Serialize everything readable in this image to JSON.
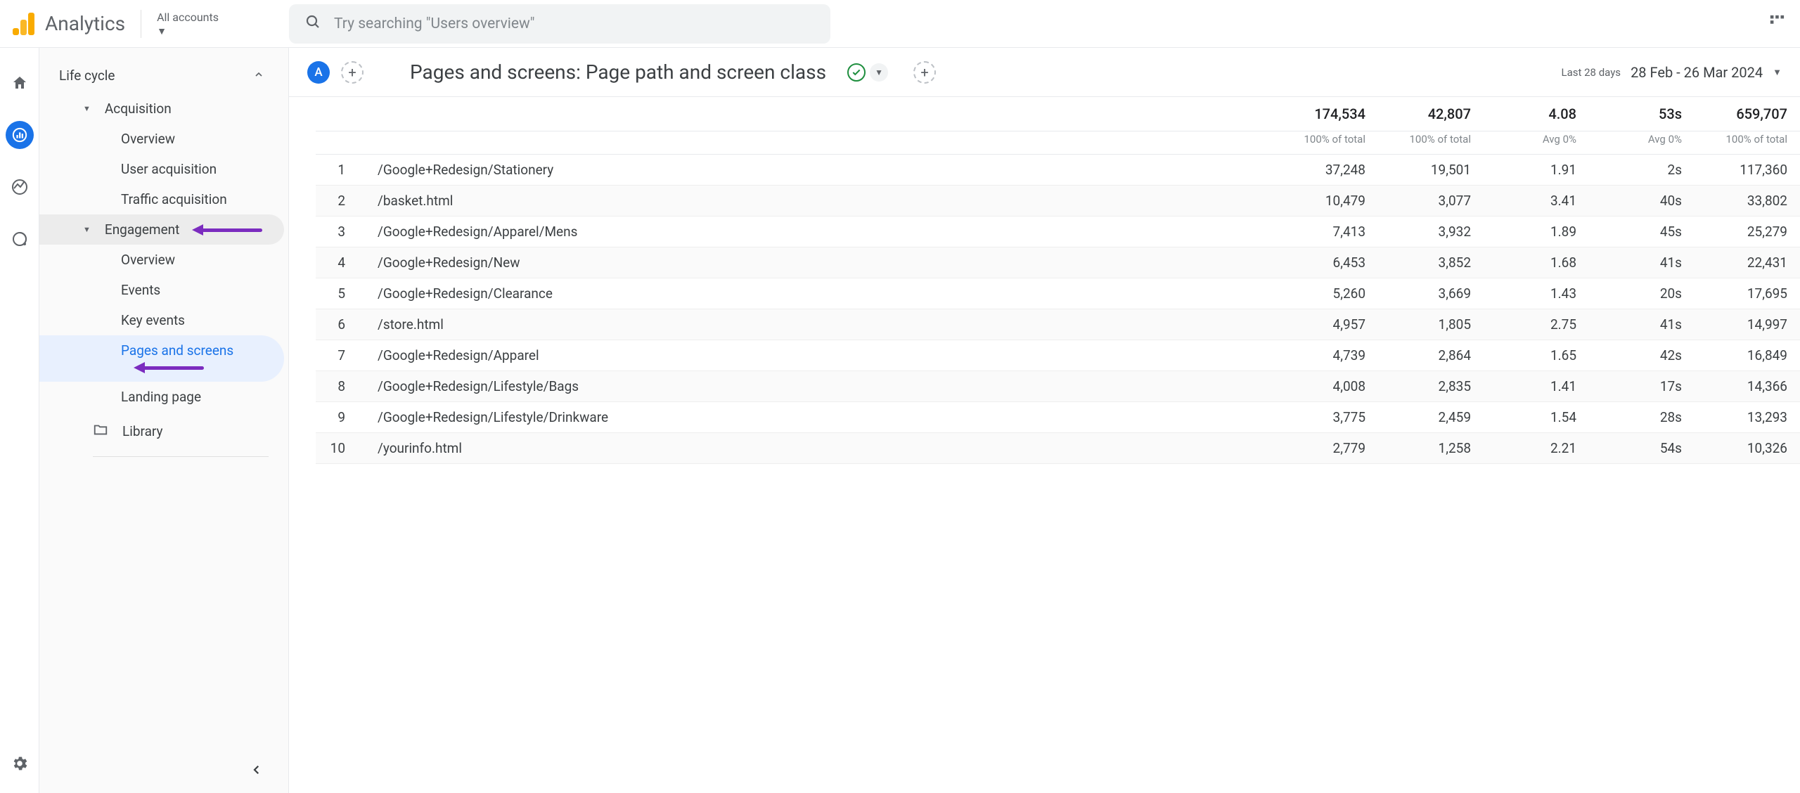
{
  "header": {
    "product": "Analytics",
    "accounts_label": "All accounts",
    "search_placeholder": "Try searching \"Users overview\""
  },
  "sidebar": {
    "section": "Life cycle",
    "groups": {
      "acquisition": {
        "label": "Acquisition",
        "items": [
          "Overview",
          "User acquisition",
          "Traffic acquisition"
        ]
      },
      "engagement": {
        "label": "Engagement",
        "items": [
          "Overview",
          "Events",
          "Key events",
          "Pages and screens",
          "Landing page"
        ],
        "active_index": 3
      }
    },
    "library": "Library"
  },
  "report": {
    "badge": "A",
    "title": "Pages and screens: Page path and screen class",
    "date_label": "Last 28 days",
    "date_value": "28 Feb - 26 Mar 2024"
  },
  "table": {
    "totals": [
      {
        "value": "174,534",
        "sub": "100% of total"
      },
      {
        "value": "42,807",
        "sub": "100% of total"
      },
      {
        "value": "4.08",
        "sub": "Avg 0%"
      },
      {
        "value": "53s",
        "sub": "Avg 0%"
      },
      {
        "value": "659,707",
        "sub": "100% of total"
      }
    ],
    "rows": [
      {
        "idx": "1",
        "path": "/Google+Redesign/Stationery",
        "cols": [
          "37,248",
          "19,501",
          "1.91",
          "2s",
          "117,360"
        ]
      },
      {
        "idx": "2",
        "path": "/basket.html",
        "cols": [
          "10,479",
          "3,077",
          "3.41",
          "40s",
          "33,802"
        ]
      },
      {
        "idx": "3",
        "path": "/Google+Redesign/Apparel/Mens",
        "cols": [
          "7,413",
          "3,932",
          "1.89",
          "45s",
          "25,279"
        ]
      },
      {
        "idx": "4",
        "path": "/Google+Redesign/New",
        "cols": [
          "6,453",
          "3,852",
          "1.68",
          "41s",
          "22,431"
        ]
      },
      {
        "idx": "5",
        "path": "/Google+Redesign/Clearance",
        "cols": [
          "5,260",
          "3,669",
          "1.43",
          "20s",
          "17,695"
        ]
      },
      {
        "idx": "6",
        "path": "/store.html",
        "cols": [
          "4,957",
          "1,805",
          "2.75",
          "41s",
          "14,997"
        ]
      },
      {
        "idx": "7",
        "path": "/Google+Redesign/Apparel",
        "cols": [
          "4,739",
          "2,864",
          "1.65",
          "42s",
          "16,849"
        ]
      },
      {
        "idx": "8",
        "path": "/Google+Redesign/Lifestyle/Bags",
        "cols": [
          "4,008",
          "2,835",
          "1.41",
          "17s",
          "14,366"
        ]
      },
      {
        "idx": "9",
        "path": "/Google+Redesign/Lifestyle/Drinkware",
        "cols": [
          "3,775",
          "2,459",
          "1.54",
          "28s",
          "13,293"
        ]
      },
      {
        "idx": "10",
        "path": "/yourinfo.html",
        "cols": [
          "2,779",
          "1,258",
          "2.21",
          "54s",
          "10,326"
        ]
      }
    ]
  }
}
